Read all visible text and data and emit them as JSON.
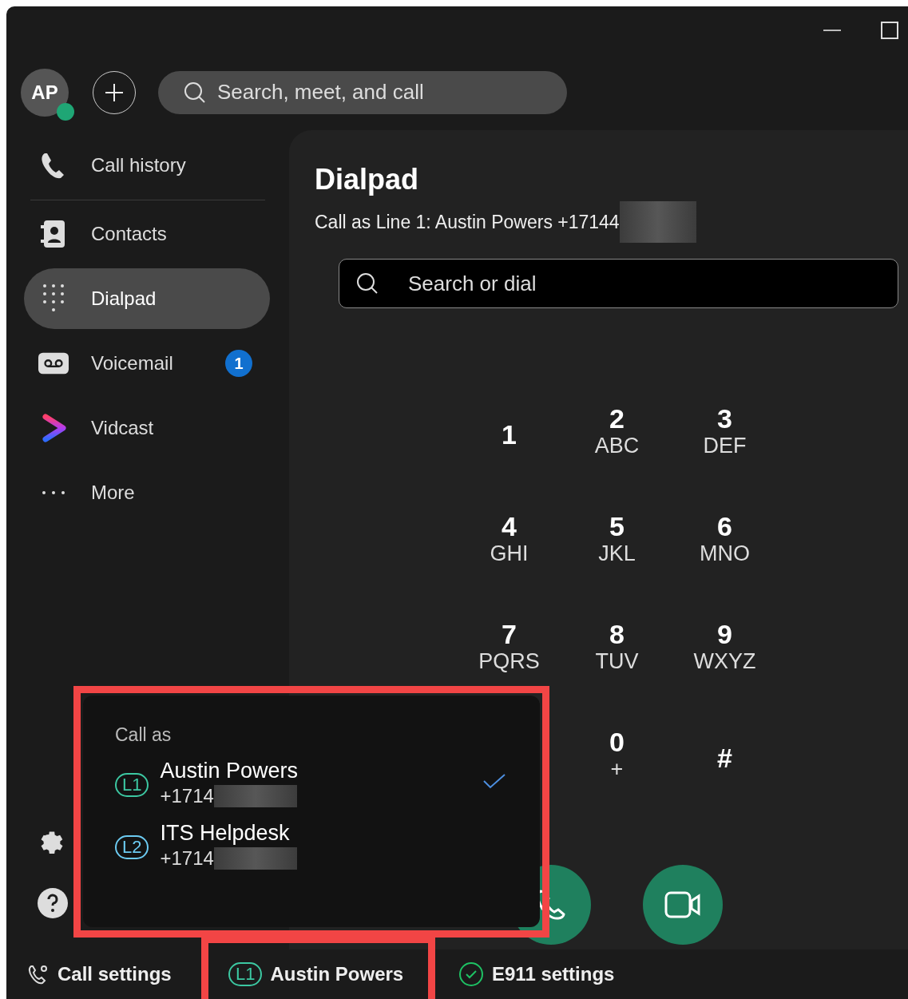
{
  "header": {
    "avatar": {
      "initials": "AP"
    },
    "search": {
      "placeholder": "Search, meet, and call"
    }
  },
  "sidebar": {
    "items": [
      {
        "label": "Call history",
        "selected": false
      },
      {
        "label": "Contacts",
        "selected": false
      },
      {
        "label": "Dialpad",
        "selected": true
      },
      {
        "label": "Voicemail",
        "selected": false,
        "badge": "1"
      },
      {
        "label": "Vidcast",
        "selected": false
      },
      {
        "label": "More",
        "selected": false
      }
    ]
  },
  "dialpad": {
    "title": "Dialpad",
    "subtitle": "Call as Line 1: Austin Powers +17144",
    "search": {
      "placeholder": "Search or dial"
    },
    "keys": [
      {
        "digit": "1"
      },
      {
        "digit": "2",
        "letters": "ABC"
      },
      {
        "digit": "3",
        "letters": "DEF"
      },
      {
        "digit": "4",
        "letters": "GHI"
      },
      {
        "digit": "5",
        "letters": "JKL"
      },
      {
        "digit": "6",
        "letters": "MNO"
      },
      {
        "digit": "7",
        "letters": "PQRS"
      },
      {
        "digit": "8",
        "letters": "TUV"
      },
      {
        "digit": "9",
        "letters": "WXYZ"
      },
      {
        "digit": "0",
        "letters": "+"
      },
      {
        "digit": "#"
      }
    ]
  },
  "call_as_menu": {
    "title": "Call as",
    "lines": [
      {
        "badge": "L1",
        "name": "Austin Powers",
        "number": "+1714",
        "selected": true,
        "color": "#3cc8a2"
      },
      {
        "badge": "L2",
        "name": "ITS Helpdesk",
        "number": "+1714",
        "selected": false,
        "color": "#6ccbf2"
      }
    ]
  },
  "footer": {
    "call_settings": "Call settings",
    "line": {
      "badge": "L1",
      "name": "Austin Powers",
      "color": "#3cc8a2"
    },
    "e911": {
      "label": "E911 settings",
      "verified": true
    }
  }
}
